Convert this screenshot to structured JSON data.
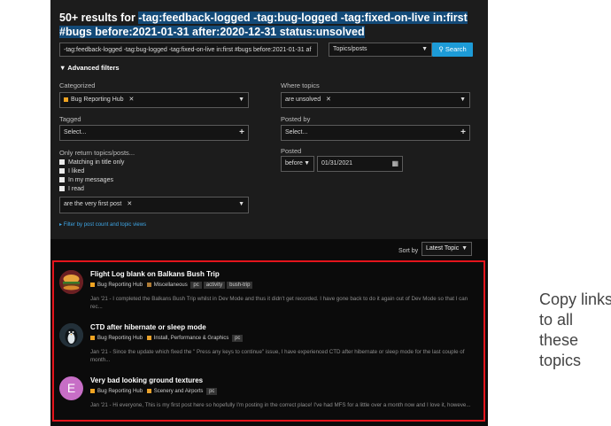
{
  "search": {
    "title_prefix": "50+ results for ",
    "title_query": "-tag:feedback-logged -tag:bug-logged -tag:fixed-on-live in:first #bugs before:2021-01-31 after:2020-12-31 status:unsolved",
    "input_value": "-tag:feedback-logged -tag:bug-logged -tag:fixed-on-live in:first #bugs before:2021-01-31 af",
    "scope": "Topics/posts",
    "button": "Search"
  },
  "advanced": {
    "toggle": "Advanced filters",
    "categorized_label": "Categorized",
    "categorized_value": "Bug Reporting Hub",
    "tagged_label": "Tagged",
    "tagged_value": "Select...",
    "only_return_label": "Only return topics/posts...",
    "only_return_options": [
      "Matching in title only",
      "I liked",
      "In my messages",
      "I read"
    ],
    "post_type_value": "are the very first post",
    "where_topics_label": "Where topics",
    "where_topics_value": "are unsolved",
    "posted_by_label": "Posted by",
    "posted_by_value": "Select...",
    "posted_label": "Posted",
    "posted_rel": "before",
    "posted_date": "01/31/2021",
    "filter_link": "Filter by post count and topic views"
  },
  "sort": {
    "label": "Sort by",
    "value": "Latest Topic"
  },
  "colors": {
    "accent": "#1d9bd7",
    "highlight": "#134a78",
    "bug_hub": "#f0a422",
    "misc": "#b07c35",
    "install": "#e8a12c",
    "scenery": "#e8a12c",
    "red_box": "#e4141c"
  },
  "results": [
    {
      "title": "Flight Log blank on Balkans Bush Trip",
      "category": "Bug Reporting Hub",
      "subcategory": "Miscellaneous",
      "tags": [
        "pc",
        "activity",
        "bush-trip"
      ],
      "excerpt": "Jan '21 - I completed the Balkans Bush Trip whilst in Dev Mode and thus it didn't get recorded. I have gone back to do it again out of Dev Mode so that I can rec...",
      "avatar_icon": "burger-avatar-icon"
    },
    {
      "title": "CTD after hibernate or sleep mode",
      "category": "Bug Reporting Hub",
      "subcategory": "Install, Performance & Graphics",
      "tags": [
        "pc"
      ],
      "excerpt": "Jan '21 - Since the update which fixed the \" Press any keys to continue\" issue, I have experienced CTD after hibernate or sleep mode for the last couple of month...",
      "avatar_icon": "penguin-avatar-icon"
    },
    {
      "title": "Very bad looking ground textures",
      "category": "Bug Reporting Hub",
      "subcategory": "Scenery and Airports",
      "tags": [
        "pc"
      ],
      "excerpt": "Jan '21 - Hi everyone, This is my first post here so hopefully I'm posting in the correct place! I've had MFS for a little over a month now and I love it, howeve...",
      "avatar_letter": "E"
    }
  ],
  "annotation": "Copy links to all these topics"
}
